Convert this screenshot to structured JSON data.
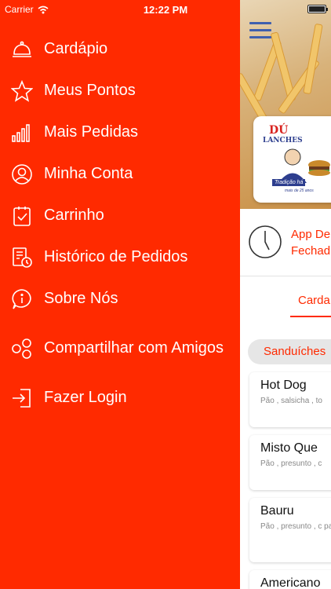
{
  "status_bar": {
    "carrier": "Carrier",
    "time": "12:22 PM"
  },
  "menu": {
    "items": [
      {
        "label": "Cardápio",
        "icon": "cloche-icon"
      },
      {
        "label": "Meus Pontos",
        "icon": "star-icon"
      },
      {
        "label": "Mais Pedidas",
        "icon": "bar-chart-icon"
      },
      {
        "label": "Minha Conta",
        "icon": "user-circle-icon"
      },
      {
        "label": "Carrinho",
        "icon": "cart-check-icon"
      },
      {
        "label": "Histórico de Pedidos",
        "icon": "history-list-icon"
      },
      {
        "label": "Sobre Nós",
        "icon": "info-bubble-icon"
      },
      {
        "label": "Compartilhar com Amigos",
        "icon": "share-icon"
      },
      {
        "label": "Fazer Login",
        "icon": "login-icon"
      }
    ]
  },
  "main": {
    "logo": {
      "title": "DÚ",
      "subtitle": "LANCHES",
      "tag": "Tradição há",
      "tag2": "mais de 25 anos"
    },
    "info": {
      "line1": "App De",
      "line2": "Fechad"
    },
    "tab": "Carda",
    "category": "Sanduíches",
    "products": [
      {
        "name": "Hot Dog",
        "desc": "Pão , salsicha , to"
      },
      {
        "name": "Misto Que",
        "desc": "Pão , presunto , c"
      },
      {
        "name": "Bauru",
        "desc": "Pão , presunto , c palha."
      },
      {
        "name": "Americano",
        "desc": ""
      }
    ]
  },
  "colors": {
    "accent": "#ff2a00",
    "menu_bg": "#ff2a00",
    "icon_blue": "#3f5fae"
  }
}
